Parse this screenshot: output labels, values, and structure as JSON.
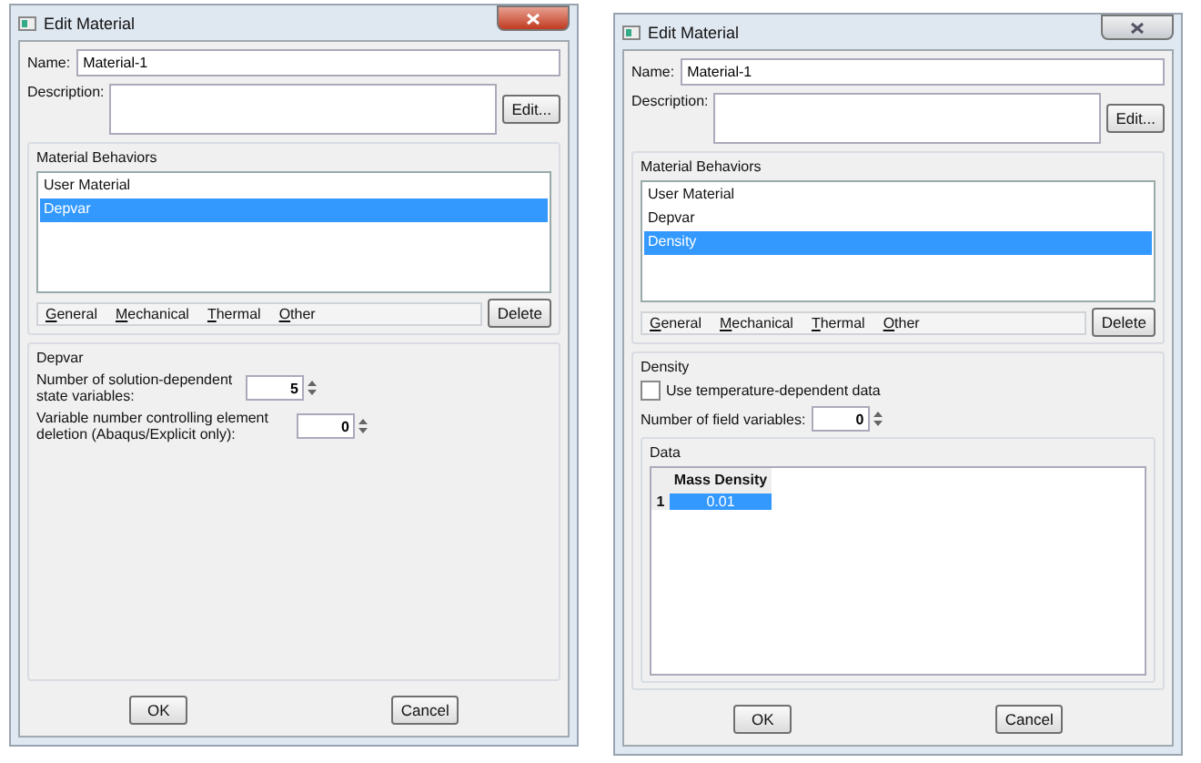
{
  "dialogs": [
    {
      "title": "Edit Material",
      "active": true,
      "name_label": "Name:",
      "name_value": "Material-1",
      "description_label": "Description:",
      "edit_button": "Edit...",
      "behaviors_title": "Material Behaviors",
      "behaviors": [
        {
          "label": "User Material",
          "selected": false
        },
        {
          "label": "Depvar",
          "selected": true
        }
      ],
      "menus": [
        "General",
        "Mechanical",
        "Thermal",
        "Other"
      ],
      "delete_button": "Delete",
      "section": {
        "kind": "depvar",
        "title": "Depvar",
        "fields": [
          {
            "label": "Number of solution-dependent state variables:",
            "value": "5"
          },
          {
            "label": "Variable number controlling element deletion (Abaqus/Explicit only):",
            "value": "0"
          }
        ]
      },
      "ok_button": "OK",
      "cancel_button": "Cancel"
    },
    {
      "title": "Edit Material",
      "active": false,
      "name_label": "Name:",
      "name_value": "Material-1",
      "description_label": "Description:",
      "edit_button": "Edit...",
      "behaviors_title": "Material Behaviors",
      "behaviors": [
        {
          "label": "User Material",
          "selected": false
        },
        {
          "label": "Depvar",
          "selected": false
        },
        {
          "label": "Density",
          "selected": true
        }
      ],
      "menus": [
        "General",
        "Mechanical",
        "Thermal",
        "Other"
      ],
      "delete_button": "Delete",
      "section": {
        "kind": "density",
        "title": "Density",
        "checkbox": {
          "label": "Use temperature-dependent data",
          "checked": false
        },
        "fields": [
          {
            "label": "Number of field variables:",
            "value": "0"
          }
        ],
        "data": {
          "title": "Data",
          "columns": [
            "Mass Density"
          ],
          "rows": [
            {
              "index": "1",
              "cells": [
                {
                  "value": "0.01",
                  "selected": true
                }
              ]
            }
          ]
        }
      },
      "ok_button": "OK",
      "cancel_button": "Cancel"
    }
  ]
}
